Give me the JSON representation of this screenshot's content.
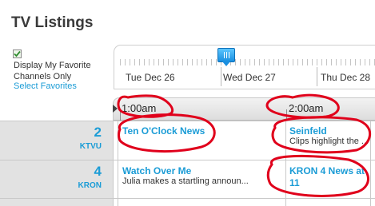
{
  "header": {
    "title": "TV Listings"
  },
  "favorites": {
    "checkbox_checked": true,
    "label": "Display My Favorite Channels Only",
    "link": "Select Favorites"
  },
  "timeline": {
    "days": [
      "Tue Dec 26",
      "Wed Dec 27",
      "Thu Dec 28"
    ],
    "handle_icon": "slider-grip-icon"
  },
  "time_header": {
    "slots": [
      "1:00am",
      "2:00am"
    ],
    "arrow_icon": "play-left-arrow-icon"
  },
  "channels": [
    {
      "number": "2",
      "callsign": "KTVU",
      "programs": [
        {
          "title": "Ten O'Clock News",
          "desc": ""
        },
        {
          "title": "Seinfeld",
          "desc": "Clips highlight the ..."
        }
      ]
    },
    {
      "number": "4",
      "callsign": "KRON",
      "programs": [
        {
          "title": "Watch Over Me",
          "desc": "Julia makes a startling announ..."
        },
        {
          "title": "KRON 4 News at 11",
          "desc": ""
        }
      ]
    }
  ],
  "colors": {
    "accent": "#1b9cd6",
    "annotation": "#e0001b"
  }
}
